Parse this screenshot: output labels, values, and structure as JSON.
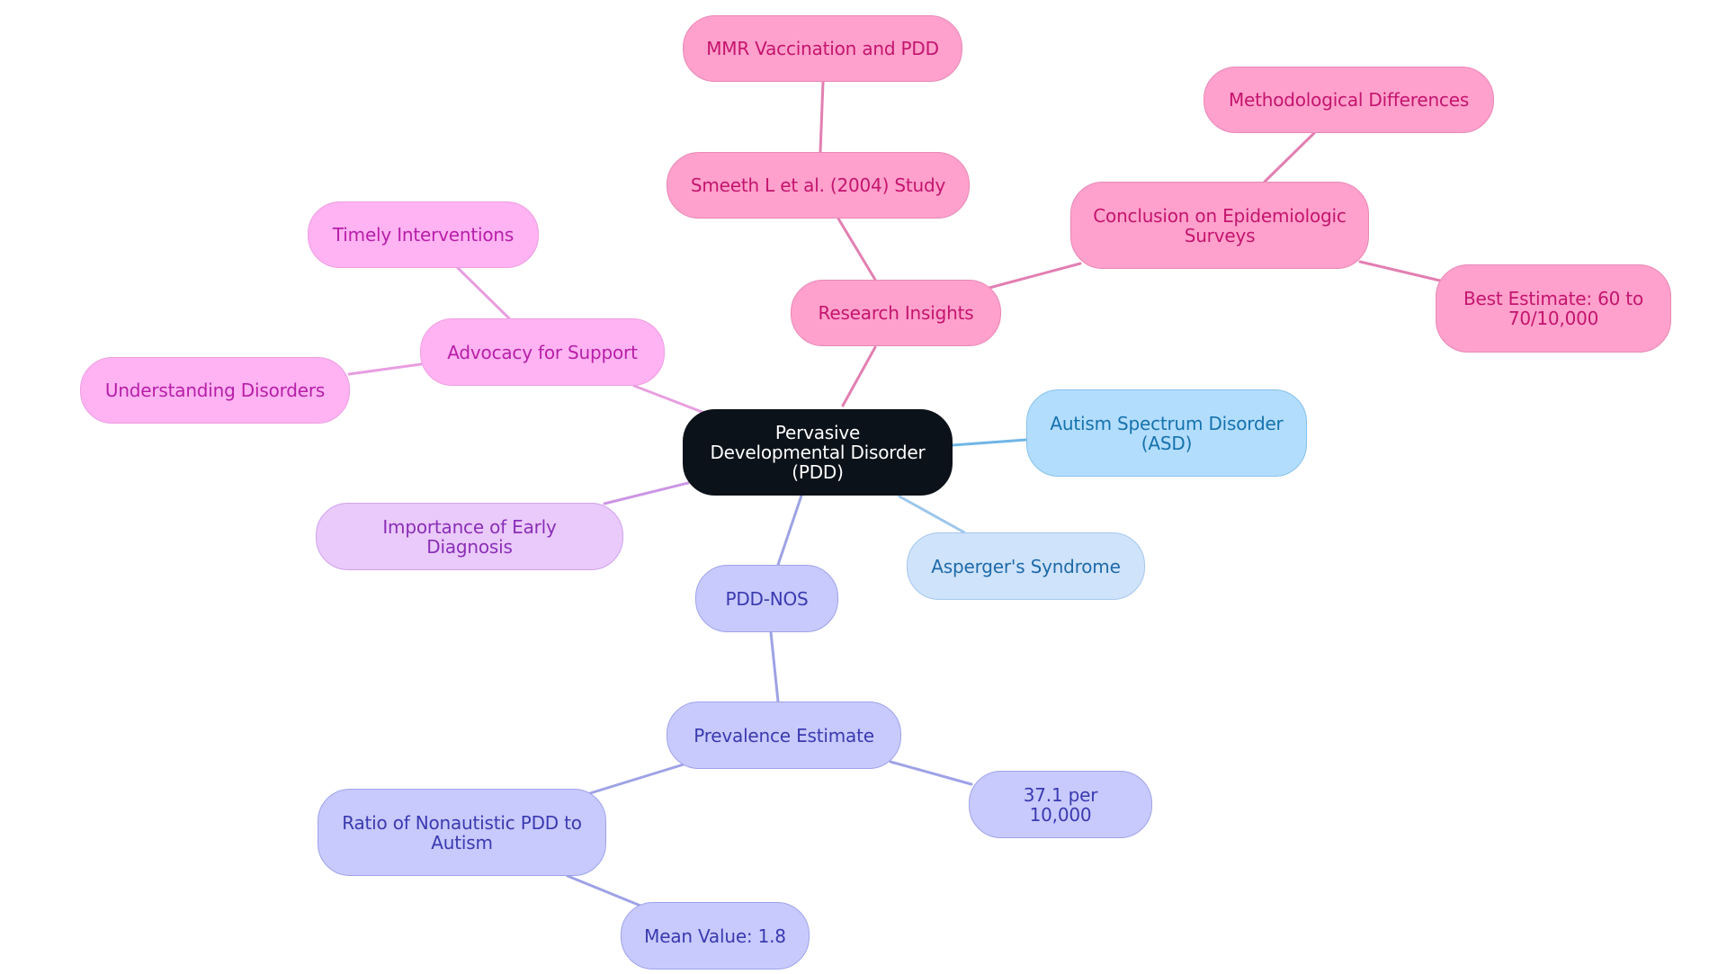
{
  "diagram": {
    "type": "mindmap",
    "root": {
      "id": "root",
      "label": "Pervasive Developmental Disorder (PDD)",
      "theme": "root"
    },
    "nodes": [
      {
        "id": "research",
        "label": "Research Insights",
        "parent": "root",
        "theme": "pink"
      },
      {
        "id": "smeeth",
        "label": "Smeeth L et al. (2004) Study",
        "parent": "research",
        "theme": "pink"
      },
      {
        "id": "mmr",
        "label": "MMR Vaccination and PDD",
        "parent": "smeeth",
        "theme": "pink"
      },
      {
        "id": "conclusion",
        "label": "Conclusion on Epidemiologic Surveys",
        "parent": "research",
        "theme": "pink"
      },
      {
        "id": "method",
        "label": "Methodological Differences",
        "parent": "conclusion",
        "theme": "pink"
      },
      {
        "id": "best",
        "label": "Best Estimate: 60 to 70/10,000",
        "parent": "conclusion",
        "theme": "pink"
      },
      {
        "id": "advocacy",
        "label": "Advocacy for Support",
        "parent": "root",
        "theme": "mag"
      },
      {
        "id": "timely",
        "label": "Timely Interventions",
        "parent": "advocacy",
        "theme": "mag"
      },
      {
        "id": "understanding",
        "label": "Understanding Disorders",
        "parent": "advocacy",
        "theme": "mag"
      },
      {
        "id": "early",
        "label": "Importance of Early Diagnosis",
        "parent": "root",
        "theme": "lav"
      },
      {
        "id": "asd",
        "label": "Autism Spectrum Disorder (ASD)",
        "parent": "root",
        "theme": "blue"
      },
      {
        "id": "asperger",
        "label": "Asperger's Syndrome",
        "parent": "root",
        "theme": "lblue"
      },
      {
        "id": "pddnos",
        "label": "PDD-NOS",
        "parent": "root",
        "theme": "peri"
      },
      {
        "id": "prevalence",
        "label": "Prevalence Estimate",
        "parent": "pddnos",
        "theme": "peri"
      },
      {
        "id": "rate",
        "label": "37.1 per 10,000",
        "parent": "prevalence",
        "theme": "peri"
      },
      {
        "id": "ratio",
        "label": "Ratio of Nonautistic PDD to Autism",
        "parent": "prevalence",
        "theme": "peri"
      },
      {
        "id": "mean",
        "label": "Mean Value: 1.8",
        "parent": "ratio",
        "theme": "peri"
      }
    ],
    "edge_colors": {
      "pink": "#e27fb2",
      "mag": "#e89ee0",
      "lav": "#cc95e4",
      "blue": "#70b6e6",
      "lblue": "#9dc6ea",
      "peri": "#9ea2e6"
    }
  }
}
